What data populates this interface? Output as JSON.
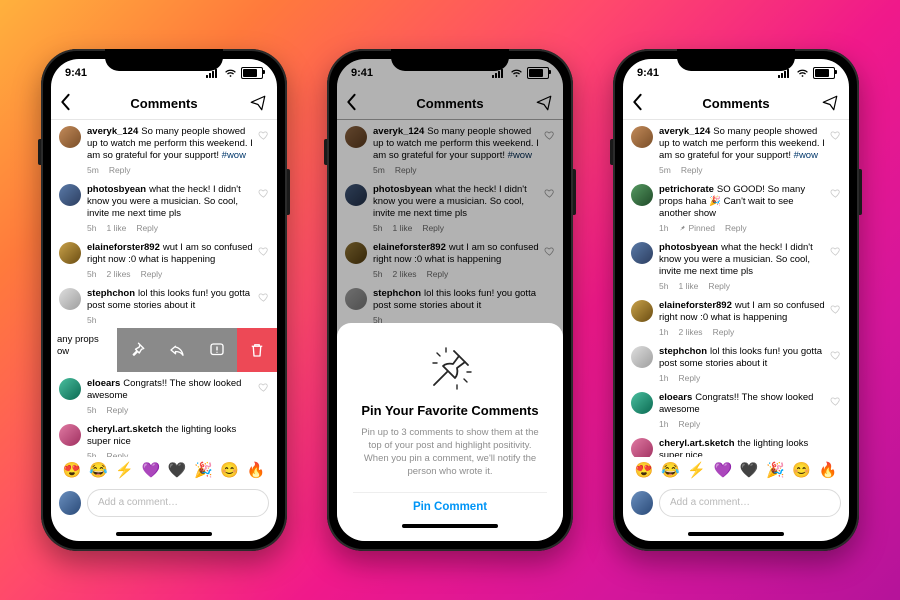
{
  "status": {
    "time": "9:41"
  },
  "nav": {
    "title": "Comments"
  },
  "compose": {
    "placeholder": "Add a comment…"
  },
  "emoji_bar": [
    "😍",
    "😂",
    "⚡",
    "💜",
    "🖤",
    "🎉",
    "😊",
    "🔥"
  ],
  "hashtag": "#wow",
  "sheet": {
    "title": "Pin Your Favorite Comments",
    "desc": "Pin up to 3 comments to show them at the top of your post and highlight positivity. When you pin a comment, we'll notify the person who wrote it.",
    "button": "Pin Comment"
  },
  "pinned_label": "Pinned",
  "labels": {
    "reply": "Reply",
    "like1": "1 like",
    "likes2": "2 likes"
  },
  "comments": {
    "avery": {
      "user": "averyk_124",
      "text": "So many people showed up to watch me perform this weekend. I am so grateful for your support! ",
      "time": "5m"
    },
    "photos": {
      "user": "photosbyean",
      "text": "what the heck! I didn't know you were a musician. So cool, invite me next time pls",
      "time": "5h"
    },
    "elaine": {
      "user": "elaineforster892",
      "text": "wut I am so confused right now :0 what is happening",
      "time": "5h"
    },
    "steph": {
      "user": "stephchon",
      "text": "lol this looks fun! you gotta post some stories about it",
      "time": "5h"
    },
    "petri": {
      "user": "petrichorate",
      "text": "SO GOOD! So many props haha 🎉 Can't wait to see another show",
      "time": "1h",
      "short_fragment": "any props\now"
    },
    "eloe": {
      "user": "eloears",
      "text": "Congrats!! The show looked awesome",
      "time": "5h"
    },
    "cheryl": {
      "user": "cheryl.art.sketch",
      "text": "the lighting looks super nice",
      "time": "5h"
    },
    "elaine3": {
      "time": "1h"
    },
    "steph3": {
      "time": "1h"
    },
    "eloe3": {
      "time": "1h"
    }
  }
}
